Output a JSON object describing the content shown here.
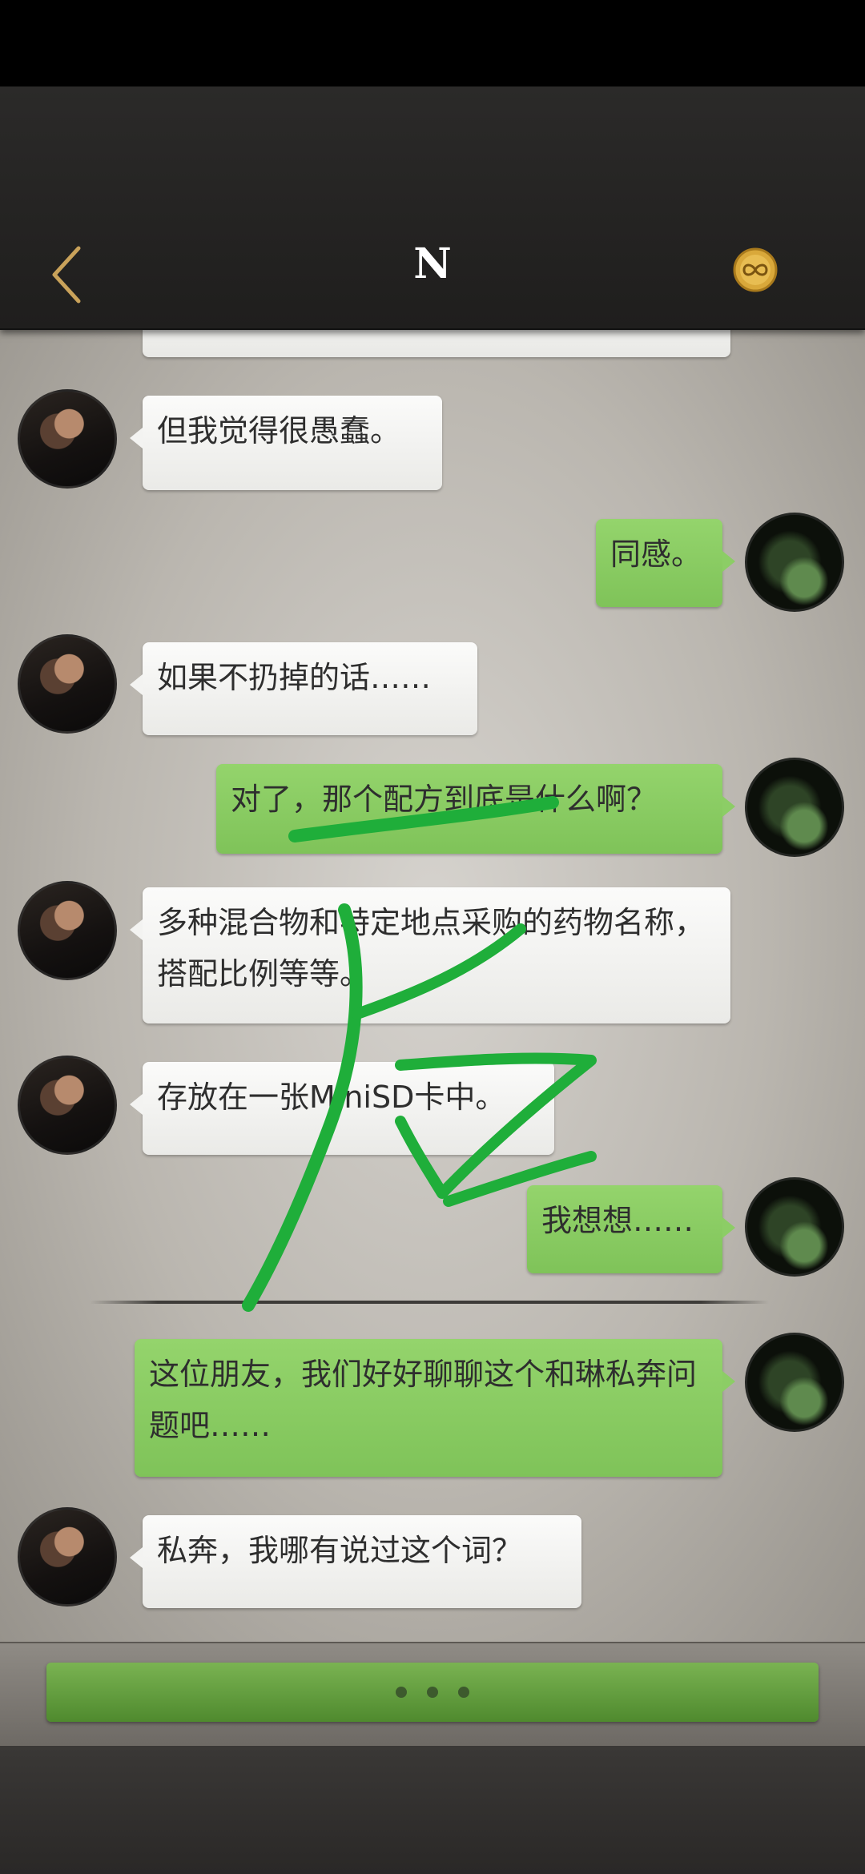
{
  "header": {
    "title": "N",
    "back_icon": "chevron-left-icon",
    "medal_icon": "infinity-medal-icon",
    "accent_color": "#c9a25a"
  },
  "messages": [
    {
      "side": "in",
      "text": "但我觉得很愚蠢。"
    },
    {
      "side": "out",
      "text": "同感。"
    },
    {
      "side": "in",
      "text": "如果不扔掉的话……"
    },
    {
      "side": "out",
      "text": "对了，那个配方到底是什么啊？"
    },
    {
      "side": "in",
      "text": "多种混合物和特定地点采购的药物名称，搭配比例等等。"
    },
    {
      "side": "in",
      "text": "存放在一张MiniSD卡中。"
    },
    {
      "side": "out",
      "text": "我想想……"
    },
    {
      "side": "out",
      "text": "这位朋友，我们好好聊聊这个和琳私奔问题吧……"
    },
    {
      "side": "in",
      "text": "私奔，我哪有说过这个词？"
    }
  ],
  "continue_button": {
    "indicator": "typing-dots",
    "color": "#6aa544"
  },
  "colors": {
    "incoming_bubble": "#f3f3f1",
    "outgoing_bubble": "#8ccd66",
    "scribble": "#1fae3a"
  }
}
